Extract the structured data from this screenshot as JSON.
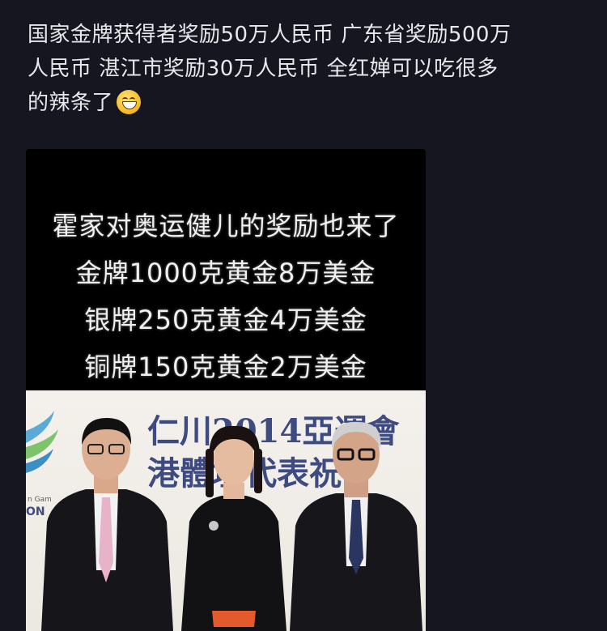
{
  "post": {
    "line1": "国家金牌获得者奖励50万人民币 广东省奖励500万",
    "line2": "人民币 湛江市奖励30万人民币 全红婵可以吃很多",
    "line3": "的辣条了",
    "emoji": "grinning-face-emoji"
  },
  "image": {
    "banner_lines": [
      "霍家对奥运健儿的奖励也来了",
      "金牌1000克黄金8万美金",
      "银牌250克黄金4万美金",
      "铜牌150克黄金2万美金"
    ],
    "backdrop_row1": "仁川2014亞運會",
    "backdrop_row2": "港體壇代表祝",
    "backdrop_side": "n Gam",
    "backdrop_side2": "ON"
  },
  "colors": {
    "background": "#15161f",
    "text": "#e8e8ec",
    "backdrop_text": "#1f2f6e"
  }
}
